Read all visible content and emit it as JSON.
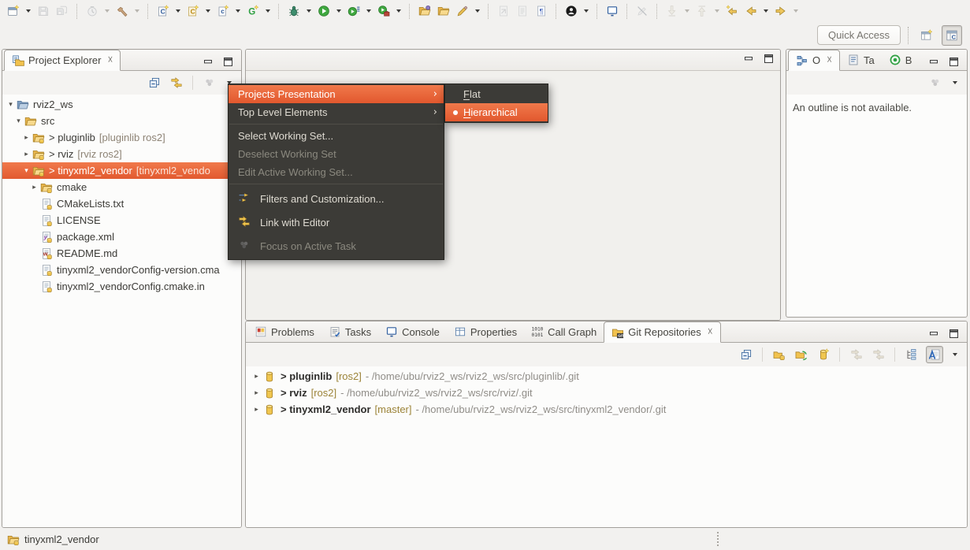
{
  "colors": {
    "accent_orange": "#E8592F",
    "selection_gradient_top": "#F0794B",
    "menu_background": "#3C3B37",
    "branch_gold": "#9C8439",
    "window_background": "#F2F1EF"
  },
  "toolbar": {
    "items": [
      {
        "icon": "new-wizard",
        "dropdown": true
      },
      {
        "icon": "save",
        "disabled": true
      },
      {
        "icon": "save-all",
        "disabled": true
      },
      {
        "sep": true
      },
      {
        "icon": "build-config",
        "disabled": true,
        "dropdown": true,
        "dropdown_disabled": true
      },
      {
        "icon": "build",
        "dropdown": true,
        "dropdown_disabled": true
      },
      {
        "sep": true
      },
      {
        "icon": "new-cpp-class",
        "dropdown": true
      },
      {
        "icon": "new-c-project",
        "dropdown": true
      },
      {
        "icon": "new-c-source",
        "dropdown": true
      },
      {
        "icon": "new-build-target",
        "dropdown": true
      },
      {
        "sep": true
      },
      {
        "icon": "debug",
        "dropdown": true
      },
      {
        "icon": "run",
        "dropdown": true
      },
      {
        "icon": "run-history",
        "dropdown": true
      },
      {
        "icon": "external-tools",
        "dropdown": true
      },
      {
        "sep": true
      },
      {
        "icon": "open-task"
      },
      {
        "icon": "open-element"
      },
      {
        "icon": "highlight",
        "dropdown": true
      },
      {
        "sep": true
      },
      {
        "icon": "previous-edit",
        "disabled": true
      },
      {
        "icon": "next-edit",
        "disabled": true
      },
      {
        "icon": "show-whitespace"
      },
      {
        "sep": true
      },
      {
        "icon": "user-profile",
        "dropdown": true
      },
      {
        "sep": true
      },
      {
        "icon": "console-monitor"
      },
      {
        "sep": true
      },
      {
        "icon": "no-active-editor",
        "disabled": true
      },
      {
        "sep": true
      },
      {
        "icon": "next-annotation",
        "disabled": true,
        "dropdown": true,
        "dropdown_disabled": true
      },
      {
        "icon": "previous-annotation",
        "disabled": true,
        "dropdown": true,
        "dropdown_disabled": true
      },
      {
        "icon": "last-edit-location"
      },
      {
        "icon": "back",
        "dropdown": true
      },
      {
        "icon": "forward",
        "dropdown": true,
        "dropdown_disabled": true
      }
    ]
  },
  "quick_access": {
    "label": "Quick Access"
  },
  "perspectives": [
    {
      "name": "open-perspective",
      "active": false
    },
    {
      "name": "cpp-perspective",
      "active": true
    }
  ],
  "project_explorer": {
    "title": "Project Explorer",
    "toolbar": [
      {
        "icon": "collapse-all"
      },
      {
        "icon": "link-editor"
      },
      {
        "sep": true
      },
      {
        "icon": "view-menu",
        "disabled": true
      },
      {
        "caret": true
      }
    ],
    "tree": [
      {
        "label": "rviz2_ws",
        "level": 0,
        "icon": "folder-blue",
        "exp": "open"
      },
      {
        "label": "src",
        "level": 1,
        "icon": "folder",
        "exp": "open"
      },
      {
        "label": "> pluginlib",
        "suffix": "[pluginlib ros2]",
        "level": 2,
        "icon": "folder-git",
        "exp": "closed"
      },
      {
        "label": "> rviz",
        "suffix": "[rviz ros2]",
        "level": 2,
        "icon": "folder-git",
        "exp": "closed"
      },
      {
        "label": "> tinyxml2_vendor",
        "suffix": "[tinyxml2_vendo",
        "level": 2,
        "icon": "folder-git",
        "exp": "open",
        "selected": true
      },
      {
        "label": "cmake",
        "level": 3,
        "icon": "folder-git",
        "exp": "closed"
      },
      {
        "label": "CMakeLists.txt",
        "level": 3,
        "icon": "file-git"
      },
      {
        "label": "LICENSE",
        "level": 3,
        "icon": "file-git"
      },
      {
        "label": "package.xml",
        "level": 3,
        "icon": "xml-git"
      },
      {
        "label": "README.md",
        "level": 3,
        "icon": "md-git"
      },
      {
        "label": "tinyxml2_vendorConfig-version.cma",
        "level": 3,
        "icon": "file-git"
      },
      {
        "label": "tinyxml2_vendorConfig.cmake.in",
        "level": 3,
        "icon": "file-git"
      }
    ]
  },
  "context_menu": {
    "items": [
      {
        "label": "Projects Presentation",
        "submenu": true,
        "highlighted": true
      },
      {
        "label": "Top Level Elements",
        "submenu": true
      },
      {
        "sep": true
      },
      {
        "label": "Select Working Set..."
      },
      {
        "label": "Deselect Working Set",
        "disabled": true
      },
      {
        "label": "Edit Active Working Set...",
        "disabled": true
      },
      {
        "sep": true
      },
      {
        "label": "Filters and Customization...",
        "icon": "filters"
      },
      {
        "label": "Link with Editor",
        "icon": "link-editor"
      },
      {
        "label": "Focus on Active Task",
        "icon": "focus-task",
        "disabled": true
      }
    ],
    "submenu": [
      {
        "label": "Flat",
        "accel": "F"
      },
      {
        "label": "Hierarchical",
        "accel": "H",
        "selected": true,
        "radio": true
      }
    ]
  },
  "outline_panel": {
    "tabs": [
      {
        "label": "O",
        "icon": "outline",
        "selected": true,
        "closable": true
      },
      {
        "label": "Ta",
        "icon": "task-list"
      },
      {
        "label": "B",
        "icon": "build-targets"
      }
    ],
    "message": "An outline is not available."
  },
  "bottom_panel": {
    "tabs": [
      {
        "label": "Problems",
        "icon": "problems"
      },
      {
        "label": "Tasks",
        "icon": "tasks"
      },
      {
        "label": "Console",
        "icon": "console-monitor"
      },
      {
        "label": "Properties",
        "icon": "properties"
      },
      {
        "label": "Call Graph",
        "icon": "call-graph"
      },
      {
        "label": "Git Repositories",
        "icon": "git-repositories",
        "selected": true,
        "closable": true
      }
    ],
    "toolbar": [
      {
        "icon": "collapse-all"
      },
      {
        "sep": true
      },
      {
        "icon": "add-repository"
      },
      {
        "icon": "clone-repository"
      },
      {
        "icon": "create-repository"
      },
      {
        "sep": true
      },
      {
        "icon": "compare-mode",
        "disabled": true
      },
      {
        "icon": "link-with-selection",
        "disabled": true
      },
      {
        "sep": true
      },
      {
        "icon": "hierarchy-layout"
      },
      {
        "icon": "toggle-decoration",
        "pressed": true
      },
      {
        "caret": true
      }
    ],
    "repos": [
      {
        "name": "> pluginlib",
        "branch": "[ros2]",
        "path": "- /home/ubu/rviz2_ws/rviz2_ws/src/pluginlib/.git"
      },
      {
        "name": "> rviz",
        "branch": "[ros2]",
        "path": "- /home/ubu/rviz2_ws/rviz2_ws/src/rviz/.git"
      },
      {
        "name": "> tinyxml2_vendor",
        "branch": "[master]",
        "path": "- /home/ubu/rviz2_ws/rviz2_ws/src/tinyxml2_vendor/.git"
      }
    ]
  },
  "status_bar": {
    "label": "tinyxml2_vendor"
  }
}
